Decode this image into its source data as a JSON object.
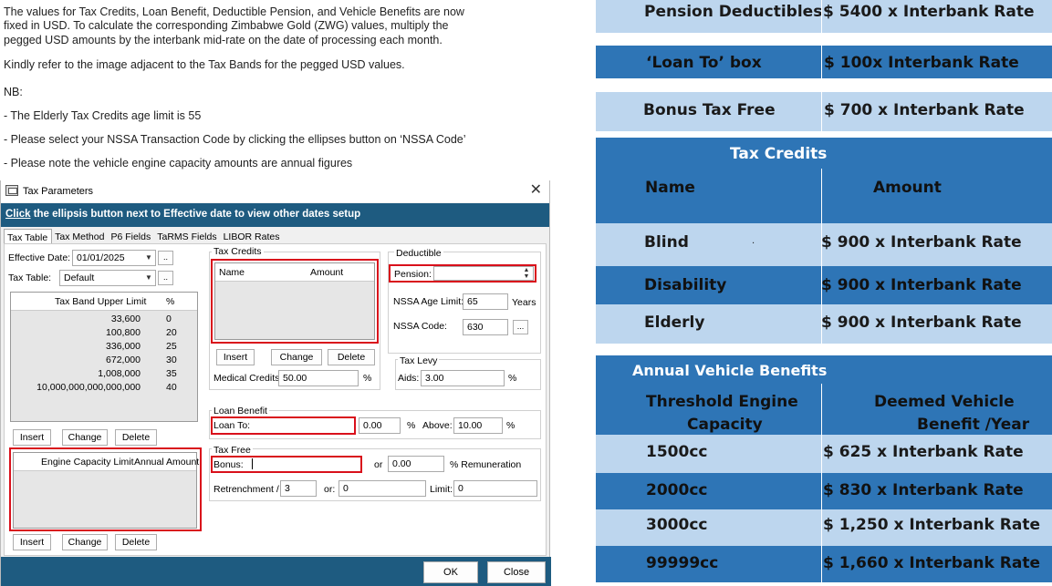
{
  "instructions": {
    "line1": "The values for Tax Credits, Loan Benefit, Deductible Pension, and Vehicle Benefits are now",
    "line2": "fixed in USD. To calculate the corresponding Zimbabwe Gold (ZWG) values, multiply the",
    "line3": "pegged USD amounts by the interbank mid-rate on the date of processing each month.",
    "line4": "Kindly refer to the image adjacent to the Tax Bands for the pegged USD values.",
    "nb": "NB:",
    "note1": "- The Elderly Tax Credits age limit is 55",
    "note2": "- Please select your NSSA Transaction Code by clicking the ellipses button on ‘NSSA Code’",
    "note3": "- Please note the vehicle engine capacity amounts are annual figures"
  },
  "dialog": {
    "title": "Tax Parameters",
    "close_glyph": "✕",
    "banner_click": "Click",
    "banner_rest": " the ellipsis button next to Effective date to view other dates setup",
    "tabs": [
      "Tax Table",
      "Tax Method",
      "P6 Fields",
      "TaRMS Fields",
      "LIBOR Rates"
    ],
    "effective_date_label": "Effective Date:",
    "effective_date_value": "01/01/2025",
    "tax_table_label": "Tax Table:",
    "tax_table_value": "Default",
    "ellipsis": "..",
    "bands_header": [
      "Tax Band Upper Limit",
      "%"
    ],
    "bands": [
      {
        "limit": "33,600",
        "pct": "0"
      },
      {
        "limit": "100,800",
        "pct": "20"
      },
      {
        "limit": "336,000",
        "pct": "25"
      },
      {
        "limit": "672,000",
        "pct": "30"
      },
      {
        "limit": "1,008,000",
        "pct": "35"
      },
      {
        "limit": "10,000,000,000,000,000",
        "pct": "40"
      }
    ],
    "insert": "Insert",
    "change": "Change",
    "delete": "Delete",
    "engine_header": [
      "Engine Capacity Limit",
      "Annual Amount"
    ],
    "tax_credits_title": "Tax Credits",
    "credits_header": [
      "Name",
      "Amount"
    ],
    "medical_credits_label": "Medical Credits:",
    "medical_credits_value": "50.00",
    "pct": "%",
    "deductible_title": "Deductible",
    "pension_label": "Pension:",
    "nssa_age_label": "NSSA Age Limit:",
    "nssa_age_value": "65",
    "years": "Years",
    "nssa_code_label": "NSSA Code:",
    "nssa_code_value": "630",
    "nssa_ellipsis": "...",
    "tax_levy_title": "Tax Levy",
    "aids_label": "Aids:",
    "aids_value": "3.00",
    "loan_benefit_title": "Loan Benefit",
    "loan_to_label": "Loan To:",
    "loan_value": "0.00",
    "above_label": "Above:",
    "above_value": "10.00",
    "tax_free_title": "Tax Free",
    "bonus_label": "Bonus:",
    "or_label": "or",
    "bonus_or_value": "0.00",
    "remuneration_label": "% Remuneration",
    "retrenchment_label": "Retrenchment /",
    "retrenchment_value": "3",
    "or2_label": "or:",
    "or2_value": "0",
    "limit_label": "Limit:",
    "limit_value": "0",
    "ok": "OK",
    "close": "Close"
  },
  "pegged": {
    "pension": {
      "name": "Pension Deductibles",
      "value": "$ 5400 x Interbank Rate"
    },
    "loan": {
      "name": "‘Loan To’ box",
      "value": "$ 100x Interbank Rate"
    },
    "bonus": {
      "name": "Bonus Tax Free",
      "value": "$ 700 x Interbank Rate"
    },
    "tax_credits_title": "Tax Credits",
    "credits_header": {
      "name": "Name",
      "amount": "Amount"
    },
    "credits": [
      {
        "name": "Blind",
        "value": "$ 900 x Interbank Rate"
      },
      {
        "name": "Disability",
        "value": "$ 900 x Interbank Rate"
      },
      {
        "name": "Elderly",
        "value": "$ 900 x Interbank Rate"
      }
    ],
    "vehicle_title": "Annual Vehicle Benefits",
    "vehicle_header": {
      "c1a": "Threshold Engine",
      "c1b": "Capacity",
      "c2a": "Deemed Vehicle",
      "c2b": "Benefit /Year"
    },
    "vehicle": [
      {
        "cc": "1500cc",
        "value": "$ 625 x Interbank Rate"
      },
      {
        "cc": "2000cc",
        "value": "$ 830 x Interbank Rate"
      },
      {
        "cc": "3000cc",
        "value": "$ 1,250 x Interbank Rate"
      },
      {
        "cc": "99999cc",
        "value": "$ 1,660 x Interbank Rate"
      }
    ],
    "dot": "."
  },
  "colors": {
    "light_blue": "#bdd6ee",
    "mid_blue": "#2e75b6",
    "banner": "#1e5b80",
    "highlight_red": "#d9101b"
  }
}
